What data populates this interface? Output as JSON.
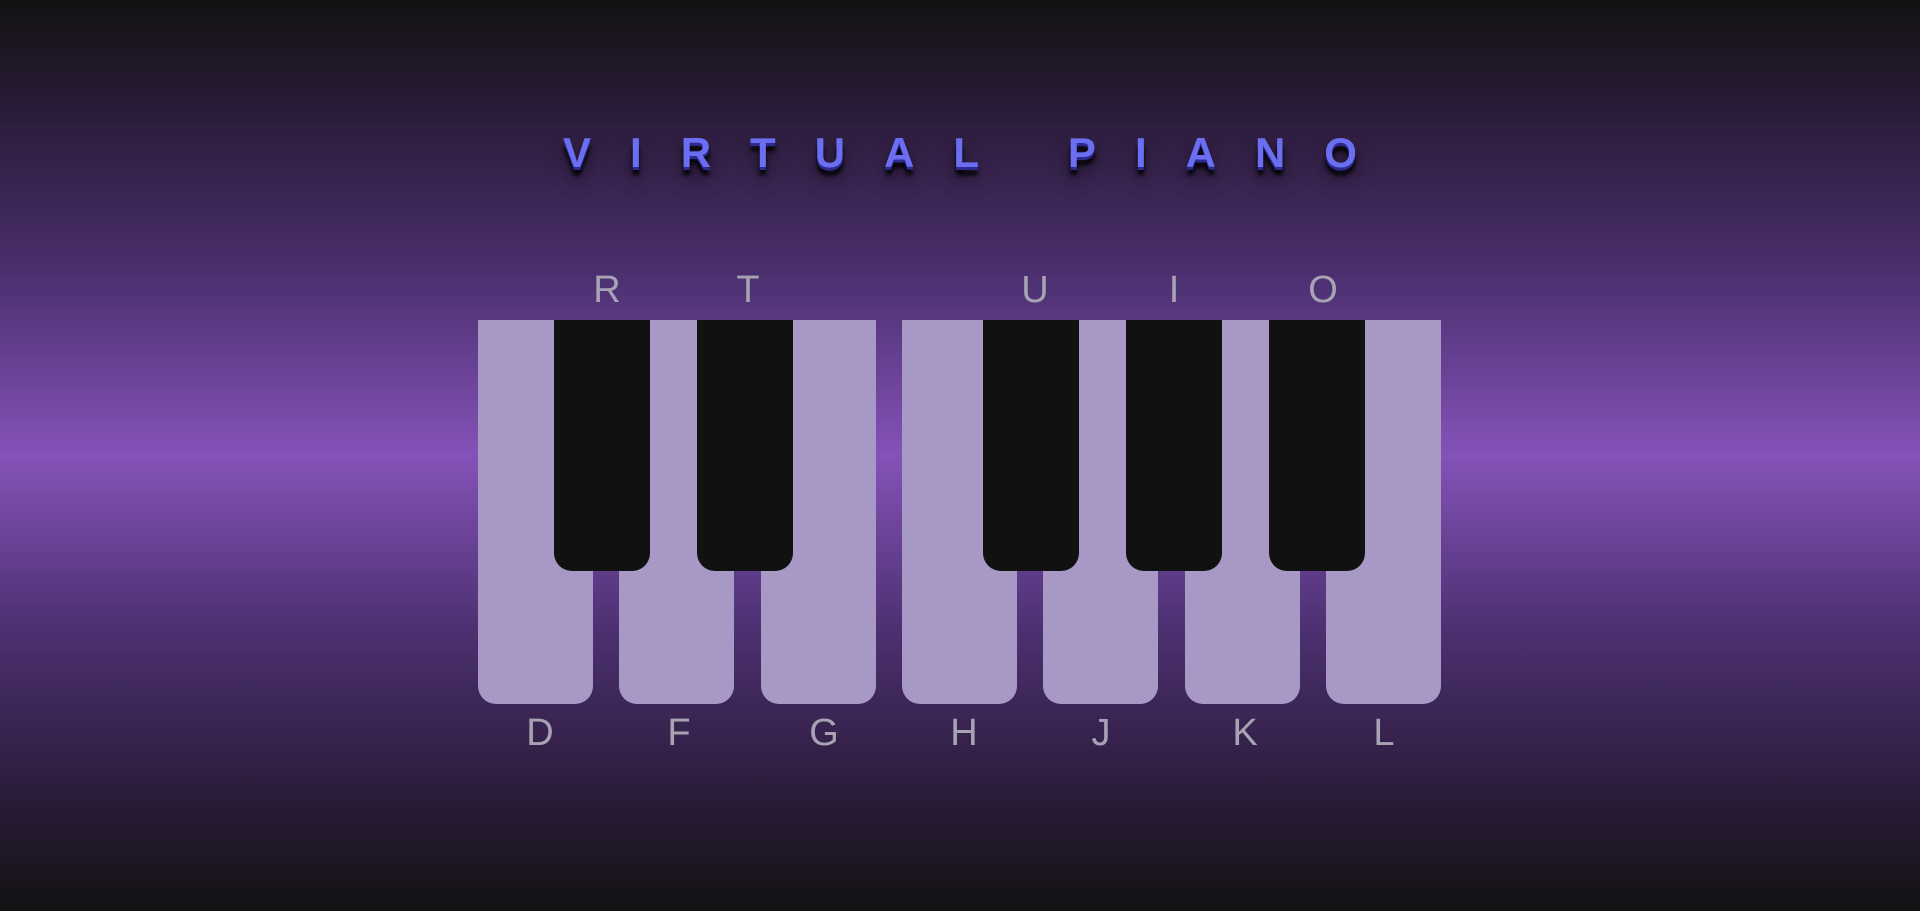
{
  "app": {
    "title": "VIRTUAL PIANO"
  },
  "keys": {
    "white": [
      {
        "key": "D"
      },
      {
        "key": "F"
      },
      {
        "key": "G"
      },
      {
        "key": "H"
      },
      {
        "key": "J"
      },
      {
        "key": "K"
      },
      {
        "key": "L"
      }
    ],
    "black": [
      {
        "key": "R"
      },
      {
        "key": "T"
      },
      {
        "key": "U"
      },
      {
        "key": "I"
      },
      {
        "key": "O"
      }
    ]
  },
  "colors": {
    "white_key": "#a898c6",
    "black_key": "#111111",
    "title": "#6b6ef0",
    "key_label": "#a8a3b4",
    "background_center": "#8452b8",
    "background_edge": "#121212"
  }
}
